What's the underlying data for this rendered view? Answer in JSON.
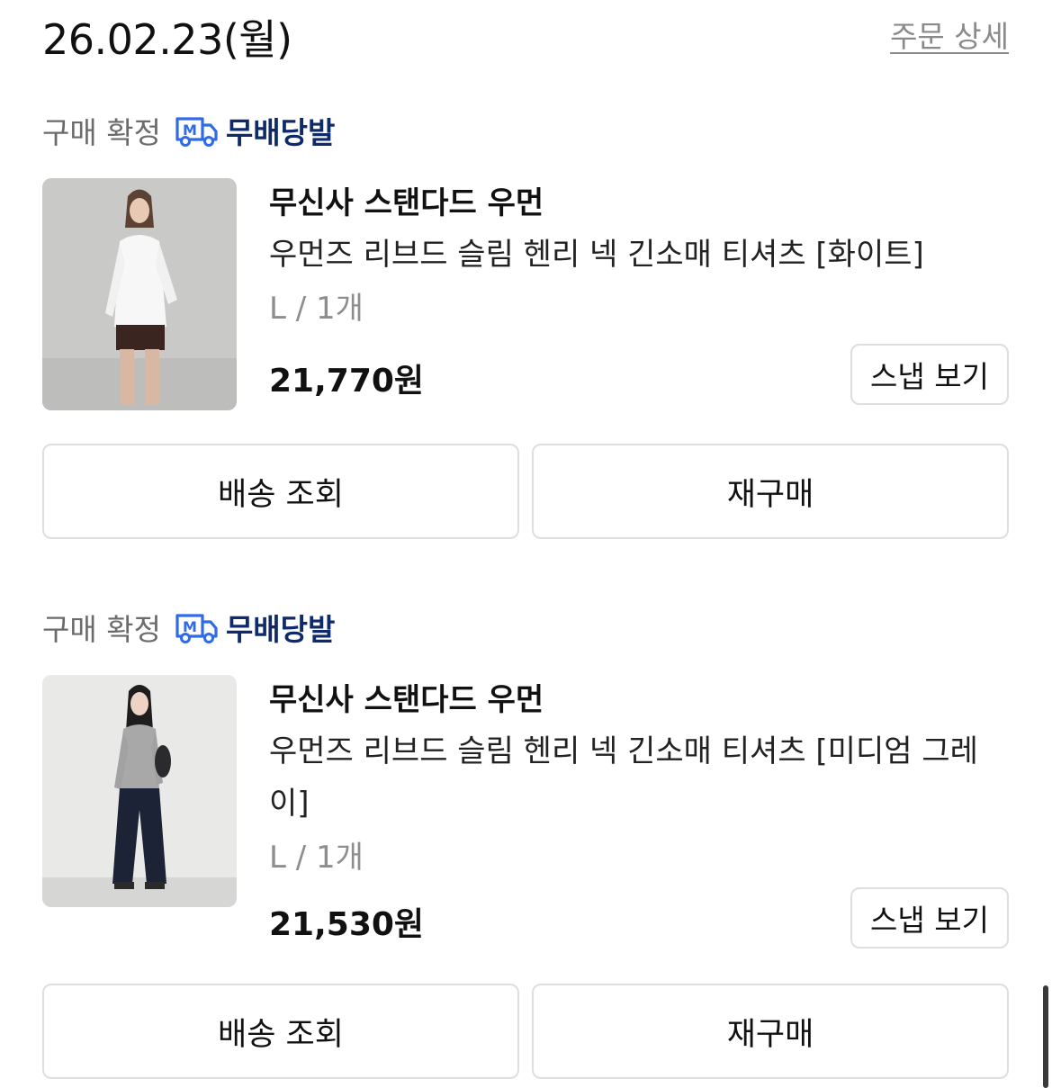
{
  "header": {
    "order_date": "26.02.23(월)",
    "order_detail_label": "주문 상세"
  },
  "items": [
    {
      "status": "구매 확정",
      "shipping_badge": "무배당발",
      "brand": "무신사 스탠다드 우먼",
      "name": "우먼즈 리브드 슬림 헨리 넥 긴소매 티셔츠 [화이트]",
      "option": "L / 1개",
      "price": "21,770원",
      "snap_label": "스냅 보기",
      "track_label": "배송 조회",
      "rebuy_label": "재구매"
    },
    {
      "status": "구매 확정",
      "shipping_badge": "무배당발",
      "brand": "무신사 스탠다드 우먼",
      "name": "우먼즈 리브드 슬림 헨리 넥 긴소매 티셔츠 [미디엄 그레이]",
      "option": "L / 1개",
      "price": "21,530원",
      "snap_label": "스냅 보기",
      "track_label": "배송 조회",
      "rebuy_label": "재구매"
    }
  ],
  "icons": {
    "shipping_badge_icon": "delivery-truck-icon",
    "truck_letter": "M"
  },
  "colors": {
    "badge_text": "#0e2a6b",
    "badge_icon": "#2f6be8",
    "status_text": "#6b6b6b",
    "border": "#dedede"
  }
}
